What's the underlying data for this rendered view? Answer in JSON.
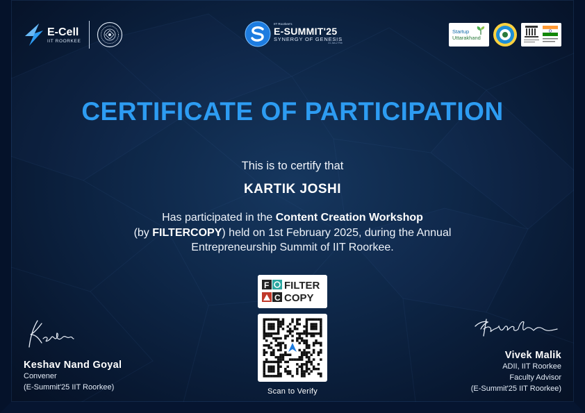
{
  "header": {
    "ecell_title": "E-Cell",
    "ecell_sub": "IIT ROORKEE",
    "esummit_top": "IIT Roorkee's",
    "esummit_title": "E-SUMMIT'25",
    "esummit_tag": "SYNERGY OF GENESIS",
    "esummit_date": "31 Jan-2 Feb",
    "startup_line1": "Startup",
    "startup_line2": "Uttarakhand"
  },
  "certificate": {
    "title": "CERTIFICATE OF PARTICIPATION",
    "intro": "This is to certify that",
    "recipient": "KARTIK JOSHI",
    "body_pre": "Has participated in the ",
    "event": "Content Creation Workshop",
    "body_mid1": "(by ",
    "sponsor": "FILTERCOPY",
    "body_mid2": ") held on 1st February 2025, during the Annual Entrepreneurship Summit of IIT Roorkee."
  },
  "sponsor_logo": {
    "line1": "FILTER",
    "line2": "COPY"
  },
  "verify": {
    "label": "Scan to Verify"
  },
  "signatories": [
    {
      "name": "Keshav Nand Goyal",
      "role1": "Convener",
      "role2": "(E-Summit'25 IIT Roorkee)"
    },
    {
      "name": "Vivek Malik",
      "role1": "ADII, IIT Roorkee",
      "role2": "Faculty Advisor",
      "role3": "(E-Summit'25 IIT Roorkee)"
    }
  ],
  "colors": {
    "title": "#2d9cf2",
    "background": "#0e2748"
  }
}
